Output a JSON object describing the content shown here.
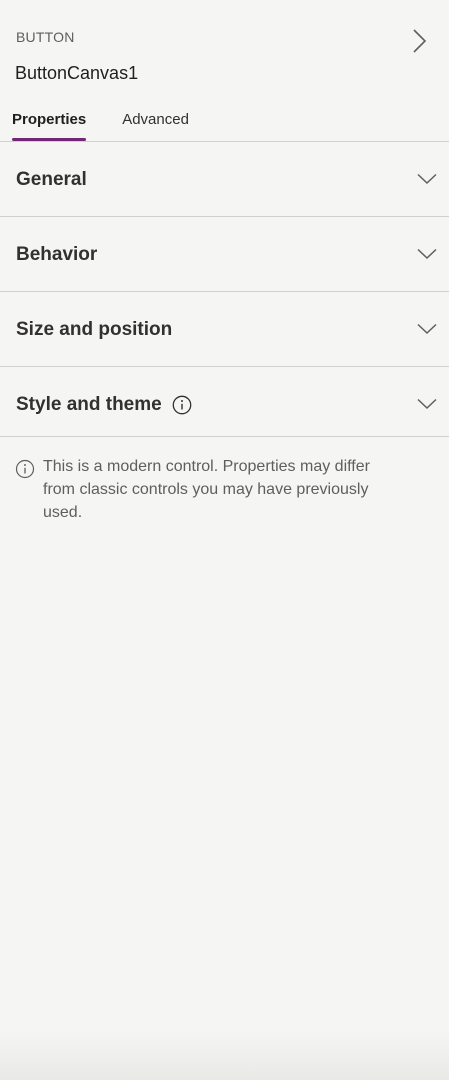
{
  "header": {
    "control_type": "BUTTON",
    "control_name": "ButtonCanvas1"
  },
  "tabs": [
    {
      "label": "Properties",
      "active": true
    },
    {
      "label": "Advanced",
      "active": false
    }
  ],
  "sections": [
    {
      "title": "General"
    },
    {
      "title": "Behavior"
    },
    {
      "title": "Size and position"
    },
    {
      "title": "Style and theme"
    }
  ],
  "notice": {
    "text": "This is a modern control. Properties may differ from classic controls you may have previously used."
  },
  "icons": {
    "collapse": "chevron-right-icon",
    "expand": "chevron-down-icon",
    "info": "info-icon"
  },
  "colors": {
    "accent": "#742774",
    "background": "#f5f5f4",
    "divider": "#d2d0ce"
  }
}
